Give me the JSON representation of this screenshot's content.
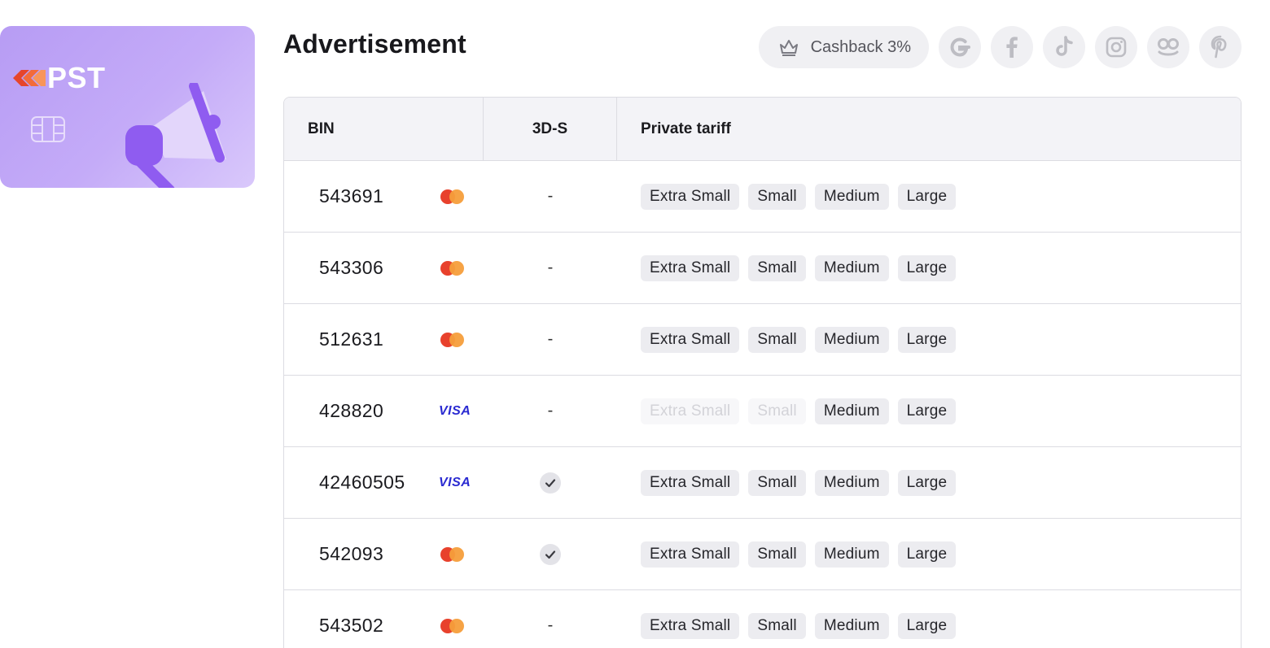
{
  "brand": {
    "logo_text": "PST",
    "icon": "megaphone-icon"
  },
  "page": {
    "title": "Advertisement"
  },
  "top_bar": {
    "cashback_label": "Cashback 3%",
    "cashback_icon": "crown-icon",
    "socials": [
      "google-icon",
      "facebook-icon",
      "tiktok-icon",
      "instagram-icon",
      "yandex-zen-icon",
      "pinterest-icon"
    ]
  },
  "table": {
    "headers": {
      "bin": "BIN",
      "three_ds": "3D-S",
      "tariff": "Private tariff"
    },
    "rows": [
      {
        "bin": "543691",
        "brand": "mastercard",
        "three_ds": "-",
        "tags": [
          {
            "label": "Extra Small",
            "enabled": true
          },
          {
            "label": "Small",
            "enabled": true
          },
          {
            "label": "Medium",
            "enabled": true
          },
          {
            "label": "Large",
            "enabled": true
          }
        ]
      },
      {
        "bin": "543306",
        "brand": "mastercard",
        "three_ds": "-",
        "tags": [
          {
            "label": "Extra Small",
            "enabled": true
          },
          {
            "label": "Small",
            "enabled": true
          },
          {
            "label": "Medium",
            "enabled": true
          },
          {
            "label": "Large",
            "enabled": true
          }
        ]
      },
      {
        "bin": "512631",
        "brand": "mastercard",
        "three_ds": "-",
        "tags": [
          {
            "label": "Extra Small",
            "enabled": true
          },
          {
            "label": "Small",
            "enabled": true
          },
          {
            "label": "Medium",
            "enabled": true
          },
          {
            "label": "Large",
            "enabled": true
          }
        ]
      },
      {
        "bin": "428820",
        "brand": "visa",
        "three_ds": "-",
        "tags": [
          {
            "label": "Extra Small",
            "enabled": false
          },
          {
            "label": "Small",
            "enabled": false
          },
          {
            "label": "Medium",
            "enabled": true
          },
          {
            "label": "Large",
            "enabled": true
          }
        ]
      },
      {
        "bin": "42460505",
        "brand": "visa",
        "three_ds": "check",
        "tags": [
          {
            "label": "Extra Small",
            "enabled": true
          },
          {
            "label": "Small",
            "enabled": true
          },
          {
            "label": "Medium",
            "enabled": true
          },
          {
            "label": "Large",
            "enabled": true
          }
        ]
      },
      {
        "bin": "542093",
        "brand": "mastercard",
        "three_ds": "check",
        "tags": [
          {
            "label": "Extra Small",
            "enabled": true
          },
          {
            "label": "Small",
            "enabled": true
          },
          {
            "label": "Medium",
            "enabled": true
          },
          {
            "label": "Large",
            "enabled": true
          }
        ]
      },
      {
        "bin": "543502",
        "brand": "mastercard",
        "three_ds": "-",
        "tags": [
          {
            "label": "Extra Small",
            "enabled": true
          },
          {
            "label": "Small",
            "enabled": true
          },
          {
            "label": "Medium",
            "enabled": true
          },
          {
            "label": "Large",
            "enabled": true
          }
        ]
      }
    ]
  },
  "brand_labels": {
    "visa": "VISA"
  },
  "colors": {
    "accent_purple": "#b79cf4",
    "mastercard_red": "#e8412c",
    "mastercard_orange": "#f59e3b",
    "visa_blue": "#2a2ad1"
  }
}
